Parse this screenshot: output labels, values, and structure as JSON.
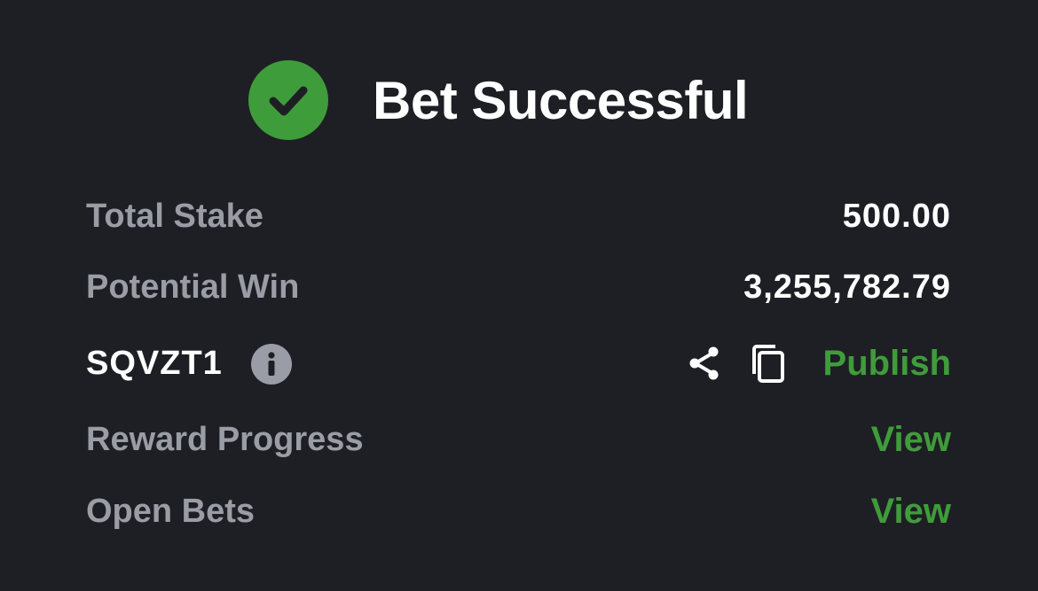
{
  "header": {
    "title": "Bet Successful",
    "icon": "check-circle-icon",
    "icon_color": "#3f9c3b"
  },
  "summary": {
    "total_stake_label": "Total Stake",
    "total_stake_value": "500.00",
    "potential_win_label": "Potential Win",
    "potential_win_value": "3,255,782.79"
  },
  "booking": {
    "code": "SQVZT1",
    "info_icon": "info-icon",
    "share_icon": "share-icon",
    "copy_icon": "copy-icon",
    "publish_label": "Publish"
  },
  "links": {
    "reward_progress_label": "Reward Progress",
    "reward_progress_action": "View",
    "open_bets_label": "Open Bets",
    "open_bets_action": "View"
  },
  "colors": {
    "background": "#1e1f24",
    "accent": "#3f9c3b",
    "muted_text": "#9a9da6",
    "primary_text": "#ffffff"
  }
}
